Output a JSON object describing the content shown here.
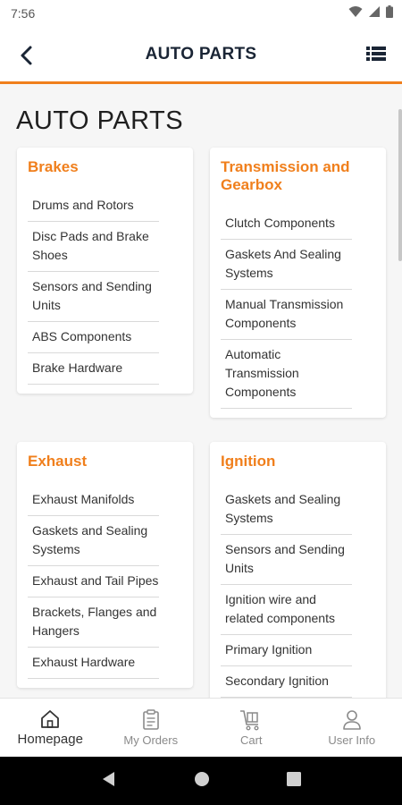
{
  "status": {
    "time": "7:56"
  },
  "header": {
    "title": "AUTO PARTS"
  },
  "page": {
    "title": "AUTO PARTS"
  },
  "categories": [
    {
      "title": "Brakes",
      "items": [
        "Drums and Rotors",
        "Disc Pads and Brake Shoes",
        "Sensors and Sending Units",
        "ABS Components",
        "Brake Hardware"
      ]
    },
    {
      "title": "Transmission and Gearbox",
      "items": [
        "Clutch Components",
        "Gaskets And Sealing Systems",
        "Manual Transmission Components",
        "Automatic Transmission Components"
      ]
    },
    {
      "title": "Exhaust",
      "items": [
        "Exhaust Manifolds",
        "Gaskets and Sealing Systems",
        "Exhaust and Tail Pipes",
        "Brackets, Flanges and Hangers",
        "Exhaust Hardware"
      ]
    },
    {
      "title": "Ignition",
      "items": [
        "Gaskets and Sealing Systems",
        "Sensors and Sending Units",
        "Ignition wire and related components",
        "Primary Ignition",
        "Secondary Ignition"
      ]
    }
  ],
  "bottom_nav": [
    {
      "label": "Homepage",
      "icon": "home-icon",
      "active": true
    },
    {
      "label": "My Orders",
      "icon": "orders-icon",
      "active": false
    },
    {
      "label": "Cart",
      "icon": "cart-icon",
      "active": false
    },
    {
      "label": "User Info",
      "icon": "user-icon",
      "active": false
    }
  ],
  "colors": {
    "accent": "#f07f1c",
    "header_text": "#1a2535"
  }
}
